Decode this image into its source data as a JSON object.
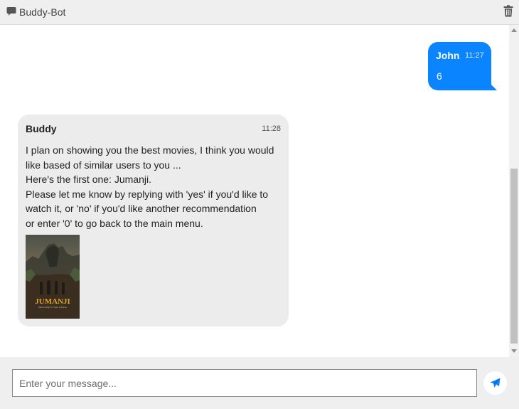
{
  "header": {
    "title": "Buddy-Bot",
    "chat_icon": "chat-bubble-icon",
    "clear_icon": "trash-icon"
  },
  "messages": [
    {
      "sender": "John",
      "time": "11:27",
      "text": "6"
    },
    {
      "sender": "Buddy",
      "time": "11:28",
      "lines": [
        "I plan on showing you the best movies, I think you would",
        "like based of similar users to you ...",
        "Here's the first one: Jumanji.",
        "Please let me know by replying with 'yes' if you'd like to",
        "watch it, or 'no' if you'd like another recommendation",
        "or enter '0' to go back to the main menu."
      ],
      "poster_title": "JUMANJI",
      "poster_subtitle": "WELCOME TO THE JUNGLE"
    }
  ],
  "composer": {
    "placeholder": "Enter your message...",
    "send_icon": "paper-plane-icon"
  },
  "colors": {
    "user_bubble": "#0a84ff",
    "bot_bubble": "#ececec",
    "header_bg": "#efefef"
  }
}
